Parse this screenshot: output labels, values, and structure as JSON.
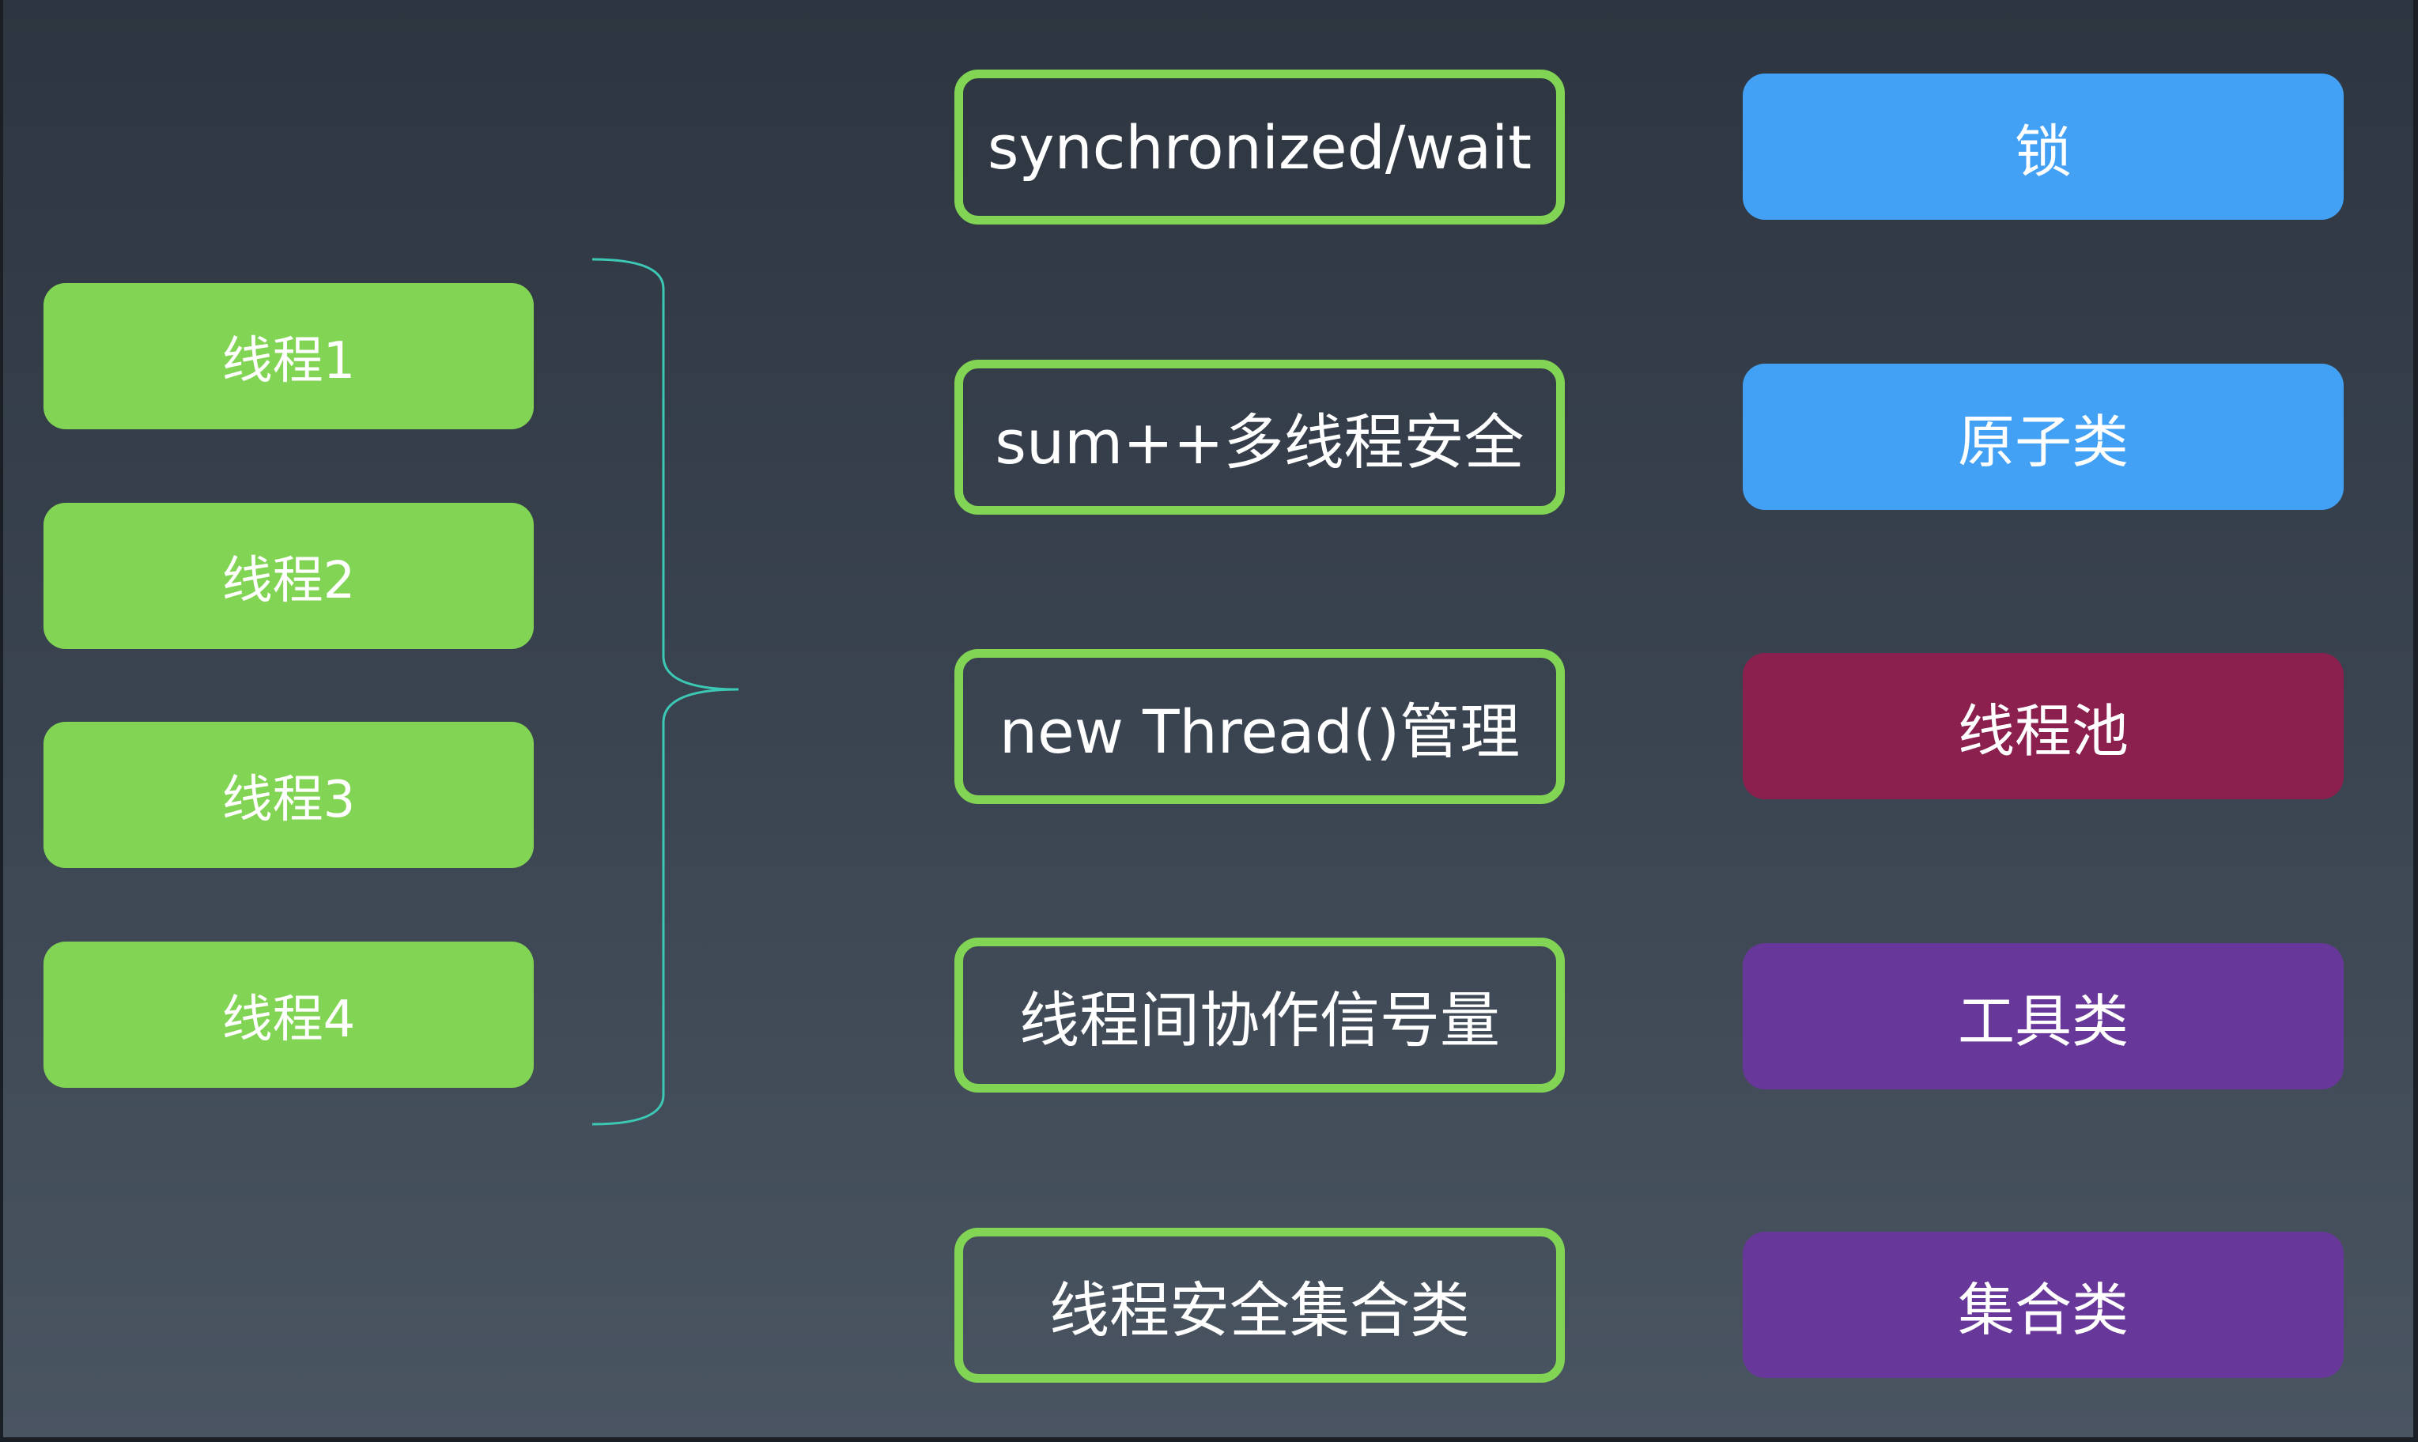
{
  "threads": [
    {
      "label": "线程1"
    },
    {
      "label": "线程2"
    },
    {
      "label": "线程3"
    },
    {
      "label": "线程4"
    }
  ],
  "problems": [
    {
      "label": "synchronized/wait"
    },
    {
      "label": "sum++多线程安全"
    },
    {
      "label": "new Thread()管理"
    },
    {
      "label": "线程间协作信号量"
    },
    {
      "label": "线程安全集合类"
    }
  ],
  "solutions": [
    {
      "label": "锁",
      "color": "#42a0f5"
    },
    {
      "label": "原子类",
      "color": "#42a0f5"
    },
    {
      "label": "线程池",
      "color": "#8b1f4e"
    },
    {
      "label": "工具类",
      "color": "#67379a"
    },
    {
      "label": "集合类",
      "color": "#67379a"
    }
  ],
  "colors": {
    "thread_fill": "#82d454",
    "problem_border": "#82d454",
    "brace_stroke": "#3cc8b4"
  }
}
